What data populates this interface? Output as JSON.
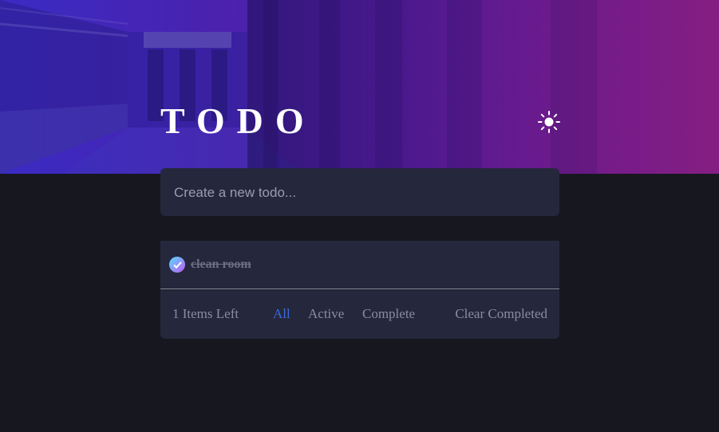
{
  "header": {
    "title": "TODO",
    "theme_icon": "sun-icon"
  },
  "new_todo": {
    "placeholder": "Create a new todo...",
    "value": ""
  },
  "todos": [
    {
      "text": "clean room",
      "completed": true
    }
  ],
  "footer": {
    "items_left": "1 Items Left",
    "filters": [
      "All",
      "Active",
      "Complete"
    ],
    "selected_filter": "All",
    "clear_label": "Clear Completed"
  },
  "colors": {
    "background": "#171720",
    "card": "#25273c",
    "accent": "#3a6bd9",
    "gradient_start": "#57ddff",
    "gradient_end": "#c058f3",
    "hero_left": "#3a2bc4",
    "hero_right": "#8a1f86"
  }
}
